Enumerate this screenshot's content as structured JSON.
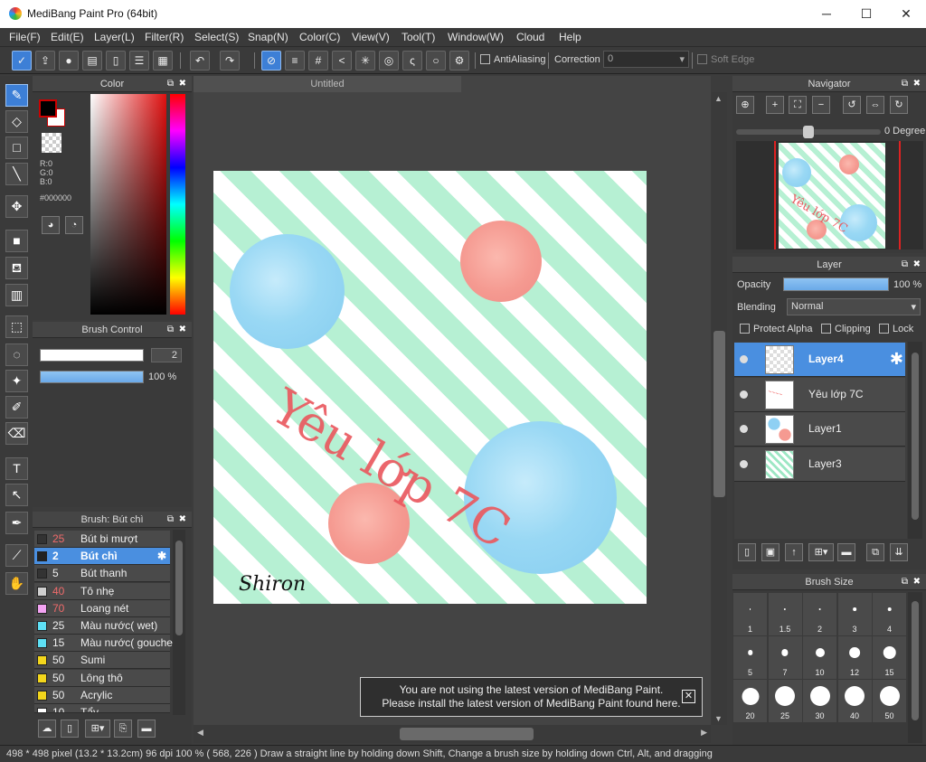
{
  "window": {
    "title": "MediBang Paint Pro (64bit)",
    "min": "─",
    "max": "☐",
    "close": "✕"
  },
  "menu": [
    "File(F)",
    "Edit(E)",
    "Layer(L)",
    "Filter(R)",
    "Select(S)",
    "Snap(N)",
    "Color(C)",
    "View(V)",
    "Tool(T)",
    "Window(W)",
    "Cloud",
    "Help"
  ],
  "toolbar": {
    "antialiasing": "AntiAliasing",
    "correction_label": "Correction",
    "correction_value": "0",
    "soft_edge": "Soft Edge"
  },
  "canvas": {
    "tab_title": "Untitled",
    "art_text": "Yêu lớp 7C",
    "signature": "Shiron"
  },
  "color_panel": {
    "title": "Color",
    "r": "R:0",
    "g": "G:0",
    "b": "B:0",
    "hex": "#000000",
    "fg": "#000000",
    "bg": "#ffffff"
  },
  "brush_control": {
    "title": "Brush Control",
    "size": "2",
    "opacity": "100 %",
    "opacity_frac": 1.0
  },
  "brush_list": {
    "title": "Brush: Bút chì",
    "items": [
      {
        "size": "25",
        "name": "Bút bi mượt",
        "color": "#333333",
        "size_color": "#f06b6b"
      },
      {
        "size": "2",
        "name": "Bút chì",
        "color": "#222222",
        "size_color": "#ffffff",
        "selected": true
      },
      {
        "size": "5",
        "name": "Bút thanh",
        "color": "#333333",
        "size_color": "#eeeeee"
      },
      {
        "size": "40",
        "name": "Tô nhẹ",
        "color": "#cfcfcf",
        "size_color": "#f06b6b"
      },
      {
        "size": "70",
        "name": "Loang nét",
        "color": "#f3a3f2",
        "size_color": "#f06b6b"
      },
      {
        "size": "25",
        "name": "Màu nước( wet)",
        "color": "#5ee0f5",
        "size_color": "#eeeeee"
      },
      {
        "size": "15",
        "name": "Màu nước( gouche",
        "color": "#5ee0f5",
        "size_color": "#eeeeee"
      },
      {
        "size": "50",
        "name": "Sumi",
        "color": "#f3d61c",
        "size_color": "#eeeeee"
      },
      {
        "size": "50",
        "name": "Lông thô",
        "color": "#f3d61c",
        "size_color": "#eeeeee"
      },
      {
        "size": "50",
        "name": "Acrylic",
        "color": "#f3d61c",
        "size_color": "#eeeeee"
      },
      {
        "size": "10",
        "name": "Tẩy",
        "color": "#ffffff",
        "size_color": "#eeeeee"
      }
    ]
  },
  "navigator": {
    "title": "Navigator",
    "degree": "0 Degree"
  },
  "layer_panel": {
    "title": "Layer",
    "opacity_label": "Opacity",
    "opacity_value": "100 %",
    "blending_label": "Blending",
    "blending_value": "Normal",
    "protect_alpha": "Protect Alpha",
    "clipping": "Clipping",
    "lock": "Lock",
    "layers": [
      {
        "name": "Layer4",
        "selected": true
      },
      {
        "name": "Yêu lớp 7C"
      },
      {
        "name": "Layer1"
      },
      {
        "name": "Layer3"
      }
    ]
  },
  "brush_size": {
    "title": "Brush Size",
    "sizes": [
      "1",
      "1.5",
      "2",
      "3",
      "4",
      "5",
      "7",
      "10",
      "12",
      "15",
      "20",
      "25",
      "30",
      "40",
      "50"
    ]
  },
  "notice": {
    "line1": "You are not using the latest version of MediBang Paint.",
    "line2": "Please install the latest version of MediBang Paint found here."
  },
  "status": "498 * 498 pixel   (13.2 * 13.2cm)   96 dpi   100 %   ( 568, 226 )   Draw a straight line by holding down Shift, Change a brush size by holding down Ctrl, Alt, and dragging"
}
